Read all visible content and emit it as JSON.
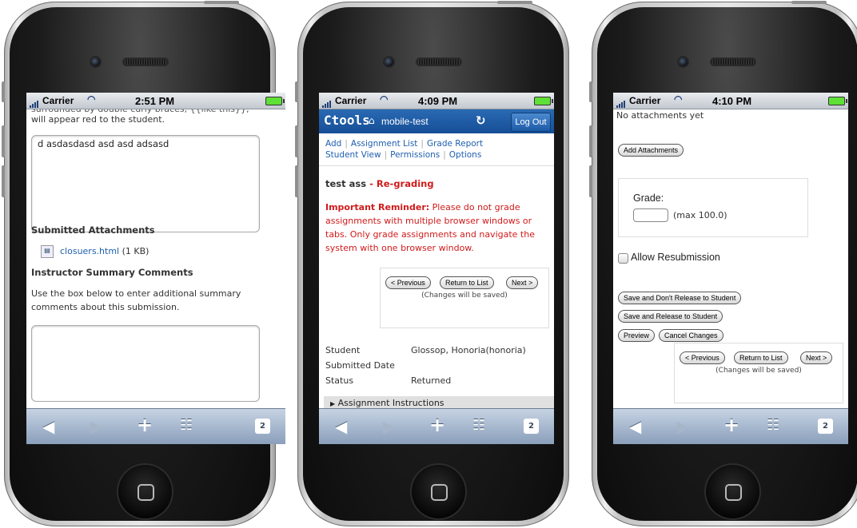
{
  "status": {
    "carrier": "Carrier",
    "times": [
      "2:51 PM",
      "4:09 PM",
      "4:10 PM"
    ]
  },
  "toolbar": {
    "back_icon": "back-arrow-icon",
    "forward_icon": "forward-arrow-icon",
    "add_icon": "plus-icon",
    "bookmarks_icon": "book-icon",
    "pages_count": "2"
  },
  "screen1": {
    "truncated_text": "surrounded by double curly braces, {{like this}},",
    "appear_text": "will appear red to the student.",
    "textbox_value": "d asdasdasd asd asd adsasd",
    "attachments_heading": "Submitted Attachments",
    "attachment_name": "closuers.html",
    "attachment_size": "(1 KB)",
    "summary_heading": "Instructor Summary Comments",
    "summary_help": "Use the box below to enter additional summary comments about this submission."
  },
  "screen2": {
    "logo": "Ctools",
    "site": "mobile-test",
    "logout": "Log Out",
    "nav": [
      "Add",
      "Assignment List",
      "Grade Report",
      "Student View",
      "Permissions",
      "Options"
    ],
    "title": "test ass",
    "title_suffix": "- Re-grading",
    "reminder_label": "Important Reminder:",
    "reminder_text": "Please do not grade assignments with multiple browser windows or tabs. Only grade assignments and navigate the system with one browser window.",
    "prev": "< Previous",
    "return": "Return to List",
    "next": "Next >",
    "changes_note": "(Changes will be saved)",
    "student_label": "Student",
    "student_value": "Glossop, Honoria(honoria)",
    "submitted_label": "Submitted Date",
    "status_label": "Status",
    "status_value": "Returned",
    "instructions": "Assignment Instructions"
  },
  "screen3": {
    "no_attachments": "No attachments yet",
    "add_attachments": "Add Attachments",
    "grade_label": "Grade:",
    "grade_max": "(max 100.0)",
    "allow_resubmission": "Allow Resubmission",
    "save_dont_release": "Save and Don't Release to Student",
    "save_release": "Save and Release to Student",
    "preview": "Preview",
    "cancel": "Cancel Changes",
    "prev": "< Previous",
    "return": "Return to List",
    "next": "Next >",
    "changes_note": "(Changes will be saved)"
  }
}
